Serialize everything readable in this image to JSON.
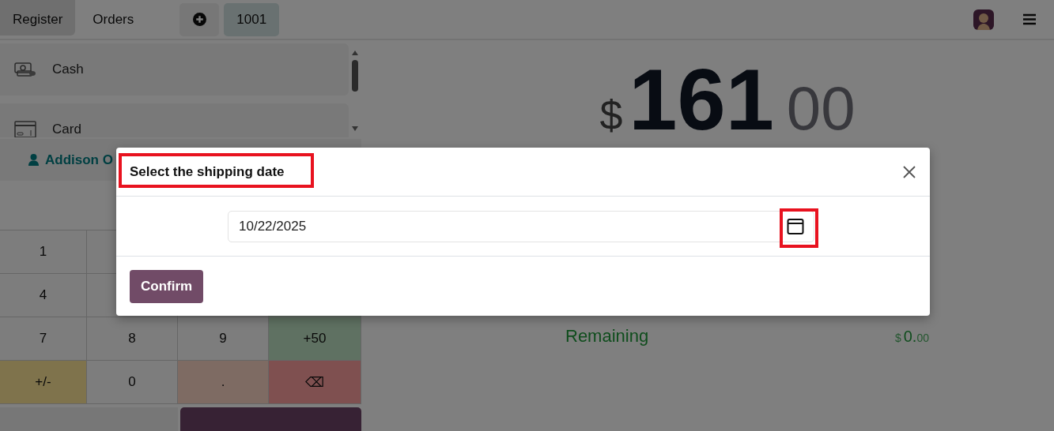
{
  "topbar": {
    "tabs": [
      {
        "label": "Register",
        "selected": true
      },
      {
        "label": "Orders",
        "selected": false
      }
    ],
    "order_buttons": [
      {
        "kind": "add"
      },
      {
        "kind": "order",
        "label": "1001"
      }
    ]
  },
  "payment_methods": [
    {
      "kind": "cash",
      "label": "Cash"
    },
    {
      "kind": "card",
      "label": "Card"
    }
  ],
  "customer": {
    "name": "Addison O"
  },
  "keypad": [
    [
      {
        "kind": "digit",
        "label": "1"
      },
      {
        "kind": "digit"
      },
      {
        "kind": "digit"
      },
      {
        "kind": "quick"
      }
    ],
    [
      {
        "kind": "digit",
        "label": "4"
      },
      {
        "kind": "digit"
      },
      {
        "kind": "digit"
      },
      {
        "kind": "quick"
      }
    ],
    [
      {
        "kind": "digit",
        "label": "7"
      },
      {
        "kind": "digit",
        "label": "8"
      },
      {
        "kind": "digit",
        "label": "9"
      },
      {
        "kind": "quick",
        "label": "+50"
      }
    ],
    [
      {
        "kind": "sign",
        "label": "+/-"
      },
      {
        "kind": "digit",
        "label": "0"
      },
      {
        "kind": "decimal",
        "label": "."
      },
      {
        "kind": "backspace",
        "label": "⌫"
      }
    ]
  ],
  "total": {
    "currency": "$",
    "whole": "161",
    "fraction": "00"
  },
  "remaining": {
    "label": "Remaining",
    "currency": "$",
    "whole": "0.",
    "fraction": "00"
  },
  "dialog": {
    "title": "Select the shipping date",
    "date": "10/22/2025",
    "confirm": "Confirm",
    "title_highlighted": true,
    "calendar_highlighted": true
  }
}
